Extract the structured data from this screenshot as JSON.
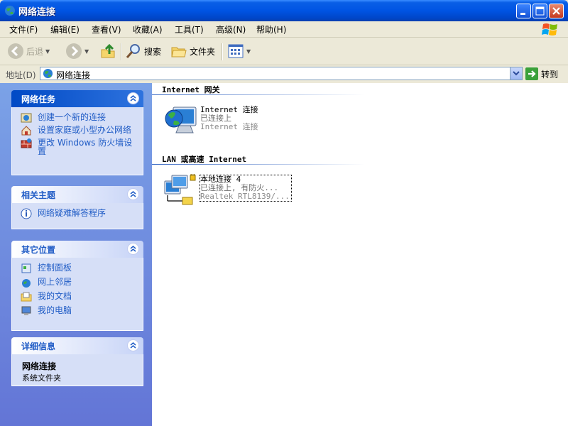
{
  "window": {
    "title": "网络连接"
  },
  "menu": [
    "文件(F)",
    "编辑(E)",
    "查看(V)",
    "收藏(A)",
    "工具(T)",
    "高级(N)",
    "帮助(H)"
  ],
  "toolbar": {
    "back": "后退",
    "search": "搜索",
    "folders": "文件夹"
  },
  "address": {
    "label": "地址(D)",
    "value": "网络连接",
    "go": "转到"
  },
  "panels": {
    "network_tasks": {
      "title": "网络任务",
      "items": [
        "创建一个新的连接",
        "设置家庭或小型办公网络",
        "更改 Windows 防火墙设置"
      ]
    },
    "related": {
      "title": "相关主题",
      "items": [
        "网络疑难解答程序"
      ]
    },
    "other_places": {
      "title": "其它位置",
      "items": [
        "控制面板",
        "网上邻居",
        "我的文档",
        "我的电脑"
      ]
    },
    "details": {
      "title": "详细信息",
      "name": "网络连接",
      "type": "系统文件夹"
    }
  },
  "groups": [
    {
      "title": "Internet 网关",
      "connections": [
        {
          "name": "Internet 连接",
          "status": "已连接上",
          "device": "Internet 连接"
        }
      ]
    },
    {
      "title": "LAN 或高速 Internet",
      "connections": [
        {
          "name": "本地连接 4",
          "status": "已连接上, 有防火...",
          "device": "Realtek RTL8139/..."
        }
      ]
    }
  ],
  "colors": {
    "title_bar": "#0054e3",
    "task_link": "#215dc6",
    "panel_bg": "#d6dff7",
    "left_pane": "#6f8ee0"
  }
}
